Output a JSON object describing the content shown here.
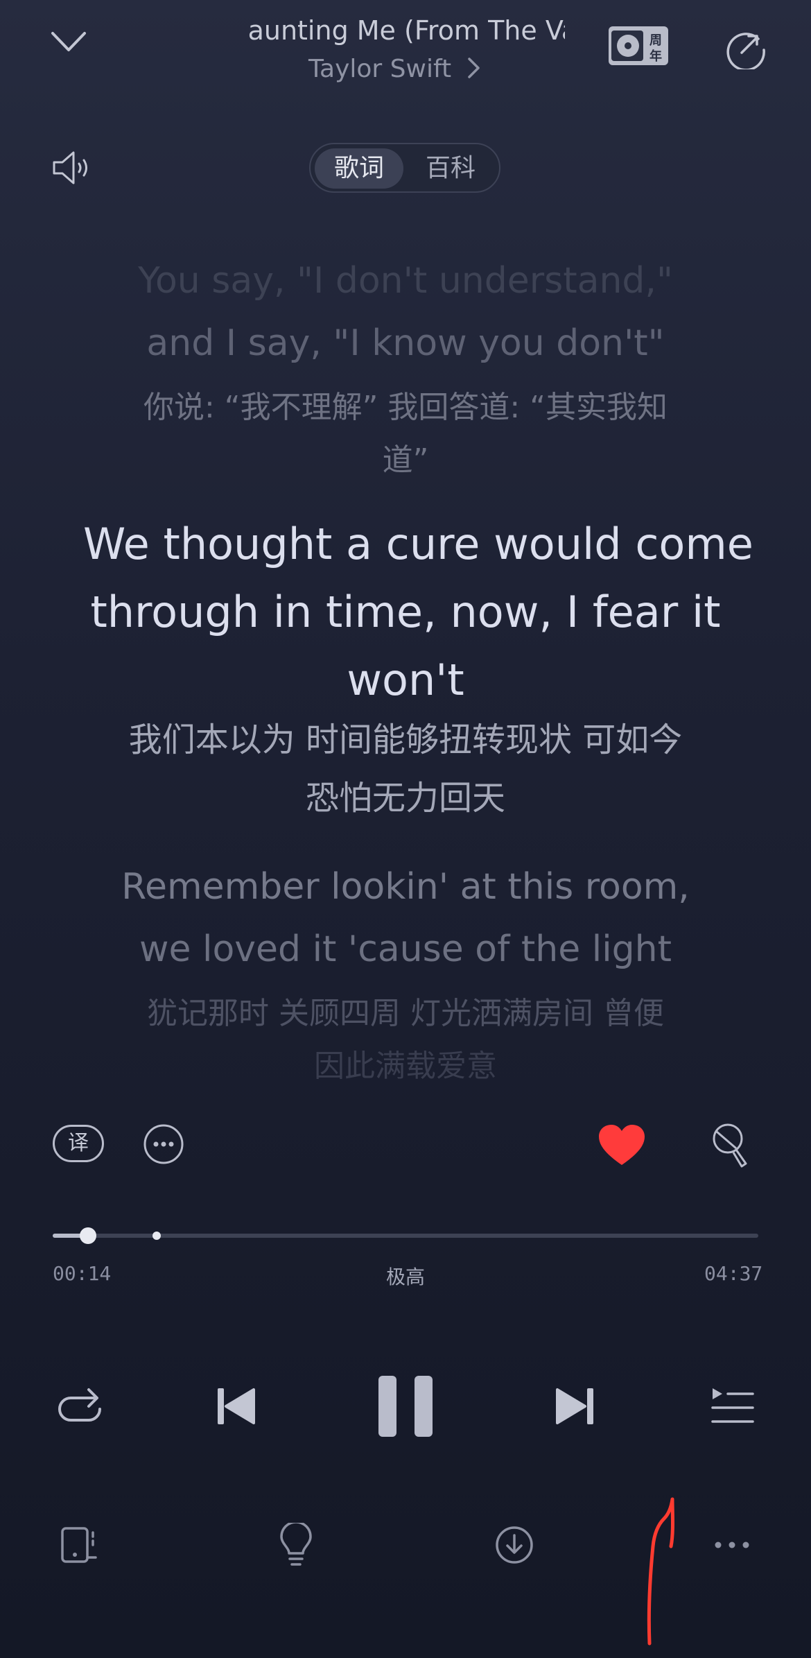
{
  "header": {
    "song_title": "Haunting Me (From The Vau",
    "artist": "Taylor Swift",
    "artist_chevron": "chevron-right-icon"
  },
  "tabs": [
    {
      "label": "歌词",
      "active": true
    },
    {
      "label": "百科",
      "active": false
    }
  ],
  "lyrics": {
    "prev_en_1": "You say, \"I don't understand,\"",
    "prev_en_2": "and I say, \"I know you don't\"",
    "prev_zh_1": "你说: “我不理解” 我回答道: “其实我知",
    "prev_zh_2": "道”",
    "cur_en_1": "We thought a cure would come",
    "cur_en_2": "through in time, now, I fear it",
    "cur_en_3": "won't",
    "cur_zh_1": "我们本以为 时间能够扭转现状 可如今",
    "cur_zh_2": "恐怕无力回天",
    "next_en_1": "Remember lookin' at this room,",
    "next_en_2": "we loved it 'cause of the light",
    "next_zh_1": "犹记那时 关顾四周 灯光洒满房间 曾便",
    "next_zh_2": "因此满载爱意"
  },
  "actions": {
    "translate_label": "译",
    "liked": true,
    "like_color": "#ff3b3b"
  },
  "progress": {
    "current_time": "00:14",
    "total_time": "04:37",
    "quality": "极高",
    "fraction": 0.05
  },
  "icons": {
    "collapse": "chevron-down-icon",
    "anniversary_badge": "vinyl-10th-anniversary-icon",
    "share": "share-icon",
    "volume": "speaker-icon",
    "more": "more-dots-icon",
    "like": "heart-icon",
    "singer_mode": "microphone-icon",
    "repeat": "repeat-icon",
    "previous": "previous-track-icon",
    "pause": "pause-icon",
    "next": "next-track-icon",
    "playlist": "playlist-icon",
    "device": "device-icon",
    "tips": "lightbulb-icon",
    "download": "download-icon",
    "bottom_more": "more-horizontal-icon"
  },
  "annotation": {
    "stroke_color": "#ff3b30"
  }
}
